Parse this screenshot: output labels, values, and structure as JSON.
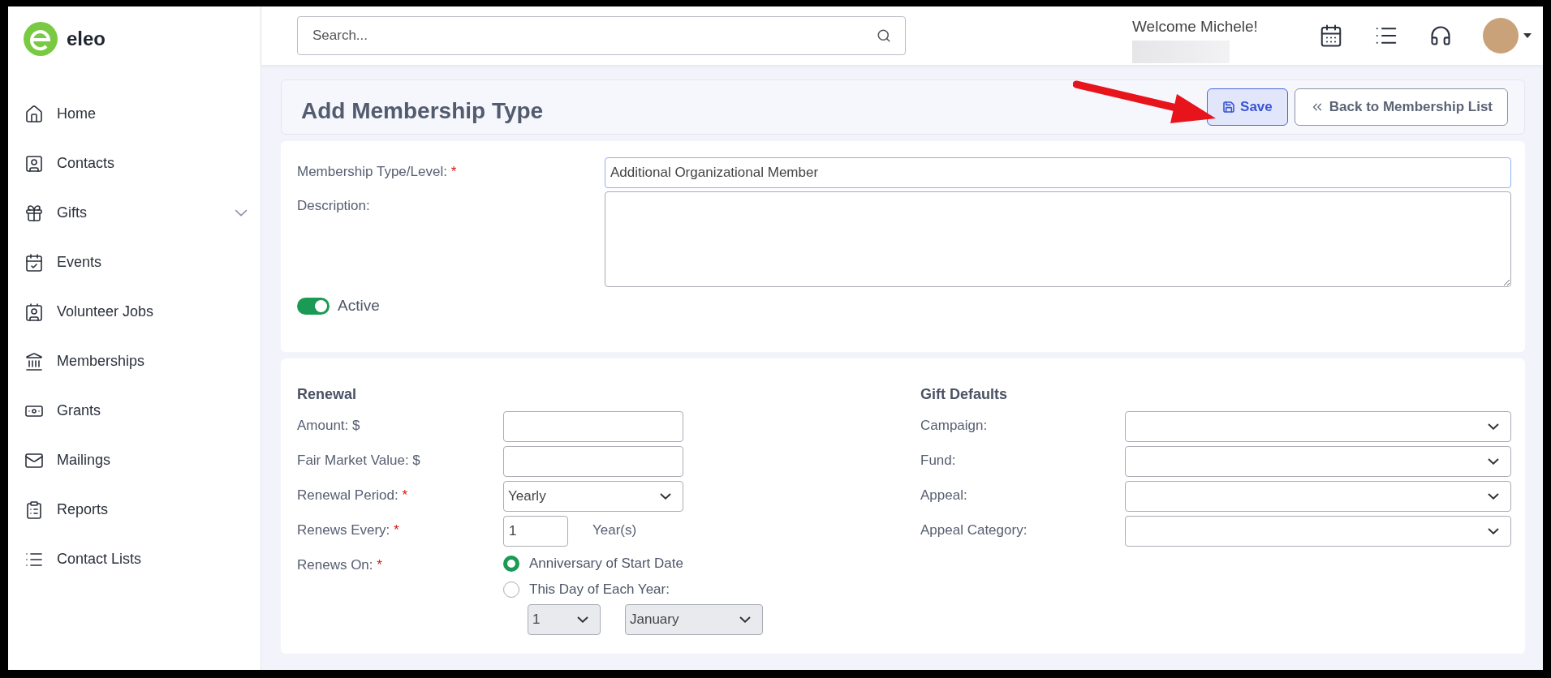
{
  "brand": {
    "name": "eleo"
  },
  "sidebar": {
    "items": [
      {
        "label": "Home",
        "has_submenu": false
      },
      {
        "label": "Contacts",
        "has_submenu": false
      },
      {
        "label": "Gifts",
        "has_submenu": true
      },
      {
        "label": "Events",
        "has_submenu": false
      },
      {
        "label": "Volunteer Jobs",
        "has_submenu": false
      },
      {
        "label": "Memberships",
        "has_submenu": false
      },
      {
        "label": "Grants",
        "has_submenu": false
      },
      {
        "label": "Mailings",
        "has_submenu": false
      },
      {
        "label": "Reports",
        "has_submenu": false
      },
      {
        "label": "Contact Lists",
        "has_submenu": false
      }
    ]
  },
  "header": {
    "search": {
      "placeholder": "Search..."
    },
    "welcome": "Welcome Michele!"
  },
  "page": {
    "title": "Add Membership Type",
    "buttons": [
      {
        "label": "Save",
        "kind": "primary"
      },
      {
        "label": "Back to Membership List",
        "kind": "secondary"
      }
    ]
  },
  "general": {
    "fields": [
      {
        "label": "Membership Type/Level:",
        "required_mark": "*",
        "kind": "text",
        "value": "Additional Organizational Member",
        "focused": true
      },
      {
        "label": "Description:",
        "kind": "textarea",
        "focused": false
      }
    ],
    "active_toggle": {
      "label": "Active",
      "on": true
    }
  },
  "renewal": {
    "title": "Renewal",
    "fields": [
      {
        "label": "Amount: $",
        "kind": "text"
      },
      {
        "label": "Fair Market Value: $",
        "kind": "text"
      },
      {
        "label": "Renewal Period:",
        "required_mark": "*",
        "kind": "select",
        "value": "Yearly"
      },
      {
        "label": "Renews Every:",
        "required_mark": "*",
        "kind": "number",
        "value": "1",
        "suffix": "Year(s)"
      },
      {
        "label": "Renews On:",
        "required_mark": "*",
        "kind": "radio",
        "options": [
          {
            "label": "Anniversary of Start Date",
            "selected": true
          },
          {
            "label": "This Day of Each Year:",
            "selected": false
          }
        ],
        "day": {
          "value": "1",
          "disabled": true
        },
        "month": {
          "value": "January",
          "disabled": true
        }
      }
    ]
  },
  "gift_defaults": {
    "title": "Gift Defaults",
    "fields": [
      {
        "label": "Campaign:",
        "kind": "select"
      },
      {
        "label": "Fund:",
        "kind": "select"
      },
      {
        "label": "Appeal:",
        "kind": "select"
      },
      {
        "label": "Appeal Category:",
        "kind": "select"
      }
    ]
  }
}
